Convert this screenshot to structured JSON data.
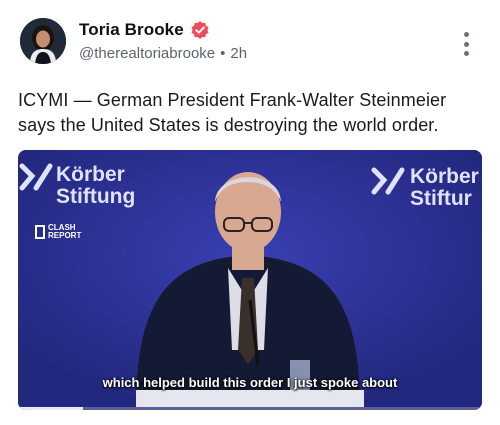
{
  "post": {
    "author": {
      "display_name": "Toria Brooke",
      "handle": "@therealtoriabrooke",
      "separator": "•",
      "time": "2h",
      "verified_color": "#f04b58"
    },
    "text": "ICYMI — German President Frank-Walter Steinmeier says the United States is destroying the world order.",
    "more_icon": "more-vertical-icon"
  },
  "video": {
    "brand_line1": "Körber",
    "brand_line2": "Stiftung",
    "brand_right_line1": "Körber",
    "brand_right_line2": "Stiftur",
    "badge_line1": "CLASH",
    "badge_line2": "REPORT",
    "subtitle": "which helped build this order I just spoke about",
    "background_color": "#2a2f9a",
    "progress": 0.14
  }
}
